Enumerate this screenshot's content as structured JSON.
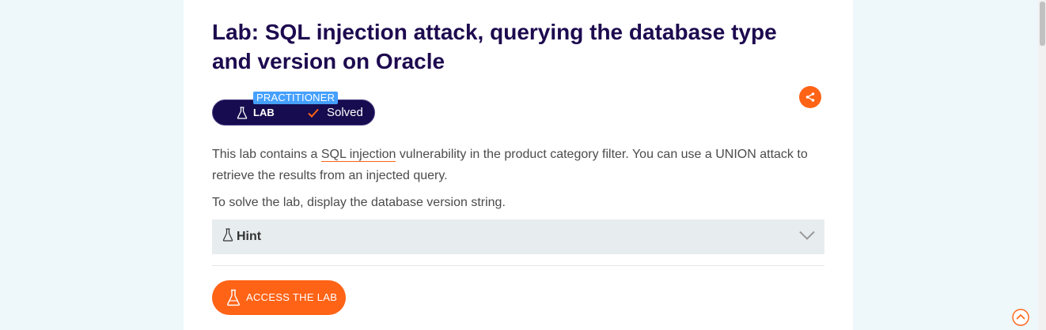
{
  "lab": {
    "title": "Lab: SQL injection attack, querying the database type and version on Oracle",
    "level": "PRACTITIONER",
    "type_label": "LAB",
    "status": "Solved",
    "description_before": "This lab contains a ",
    "description_link": "SQL injection",
    "description_after": " vulnerability in the product category filter. You can use a UNION attack to retrieve the results from an injected query.",
    "objective": "To solve the lab, display the database version string.",
    "hint_label": "Hint",
    "access_label": "ACCESS THE LAB"
  },
  "colors": {
    "accent": "#ff6316",
    "badge_bg": "#160c4f",
    "level_bg": "#45a0ff",
    "title": "#1d0a4f"
  },
  "icons": {
    "share": "share-icon",
    "flask": "flask-icon",
    "check": "check-icon",
    "chevron": "chevron-down-icon",
    "scroll_top": "scroll-to-top-icon"
  }
}
